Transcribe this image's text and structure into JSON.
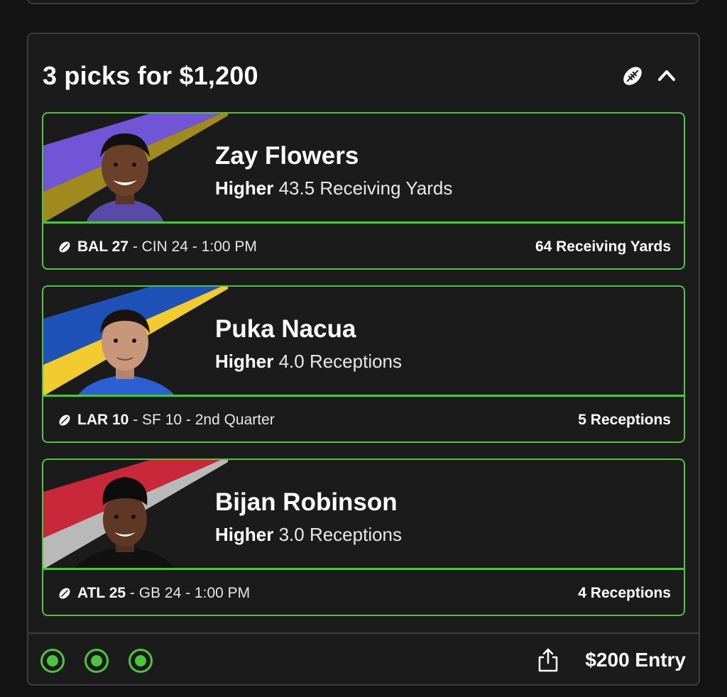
{
  "entry": {
    "title": "3 picks for $1,200",
    "entry_label": "$200 Entry",
    "icons": {
      "sport": "football-icon",
      "collapse": "chevron-up-icon",
      "share": "share-icon"
    }
  },
  "colors": {
    "accent": "#4ec33f",
    "background": "#1b1b1b"
  },
  "picks": [
    {
      "player": "Zay Flowers",
      "direction": "Higher",
      "line": "43.5 Receiving Yards",
      "team": "BAL 27",
      "rest": " - CIN 24 - 1:00 PM",
      "result": "64 Receiving Yards",
      "stripe_colors": [
        "#7155d6",
        "#a08a1e"
      ]
    },
    {
      "player": "Puka Nacua",
      "direction": "Higher",
      "line": "4.0 Receptions",
      "team": "LAR 10",
      "rest": " - SF 10 - 2nd Quarter",
      "result": "5 Receptions",
      "stripe_colors": [
        "#1f52b8",
        "#f2cc2e"
      ]
    },
    {
      "player": "Bijan Robinson",
      "direction": "Higher",
      "line": "3.0 Receptions",
      "team": "ATL 25",
      "rest": " - GB 24 - 1:00 PM",
      "result": "4 Receptions",
      "stripe_colors": [
        "#c8283a",
        "#b9b9b9"
      ]
    }
  ]
}
